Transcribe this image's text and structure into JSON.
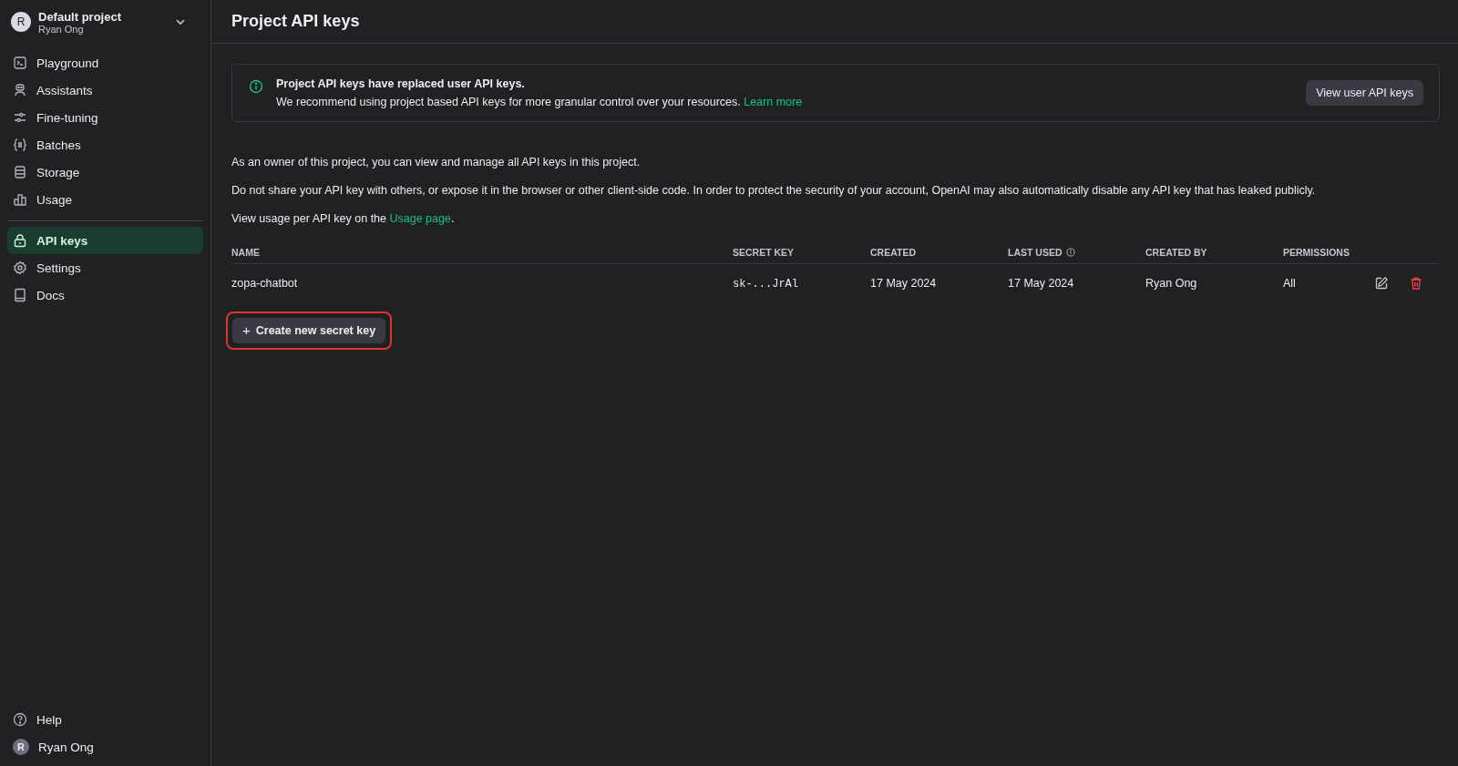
{
  "project": {
    "avatar": "R",
    "name": "Default project",
    "owner": "Ryan Ong"
  },
  "nav_top": [
    {
      "label": "Playground",
      "selected": false
    },
    {
      "label": "Assistants",
      "selected": false
    },
    {
      "label": "Fine-tuning",
      "selected": false
    },
    {
      "label": "Batches",
      "selected": false
    },
    {
      "label": "Storage",
      "selected": false
    },
    {
      "label": "Usage",
      "selected": false
    }
  ],
  "nav_bottom": [
    {
      "label": "API keys",
      "selected": true
    },
    {
      "label": "Settings",
      "selected": false
    },
    {
      "label": "Docs",
      "selected": false
    }
  ],
  "footer": {
    "help": "Help",
    "user_avatar": "R",
    "user": "Ryan Ong"
  },
  "page_title": "Project API keys",
  "notice": {
    "title": "Project API keys have replaced user API keys.",
    "text": "We recommend using project based API keys for more granular control over your resources.",
    "link": "Learn more",
    "button": "View user API keys"
  },
  "paragraphs": [
    "As an owner of this project, you can view and manage all API keys in this project.",
    "Do not share your API key with others, or expose it in the browser or other client-side code. In order to protect the security of your account, OpenAI may also automatically disable any API key that has leaked publicly."
  ],
  "usage_line": {
    "text": "View usage per API key on the",
    "link": "Usage page",
    "end": "."
  },
  "table": {
    "columns": [
      "NAME",
      "SECRET KEY",
      "CREATED",
      "LAST USED",
      "CREATED BY",
      "PERMISSIONS"
    ],
    "rows": [
      {
        "name": "zopa-chatbot",
        "secret_key": "sk-...JrAl",
        "created": "17 May 2024",
        "last_used": "17 May 2024",
        "created_by": "Ryan Ong",
        "permissions": "All"
      }
    ]
  },
  "create_button": {
    "icon": "+",
    "label": "Create new secret key",
    "highlighted": true
  }
}
